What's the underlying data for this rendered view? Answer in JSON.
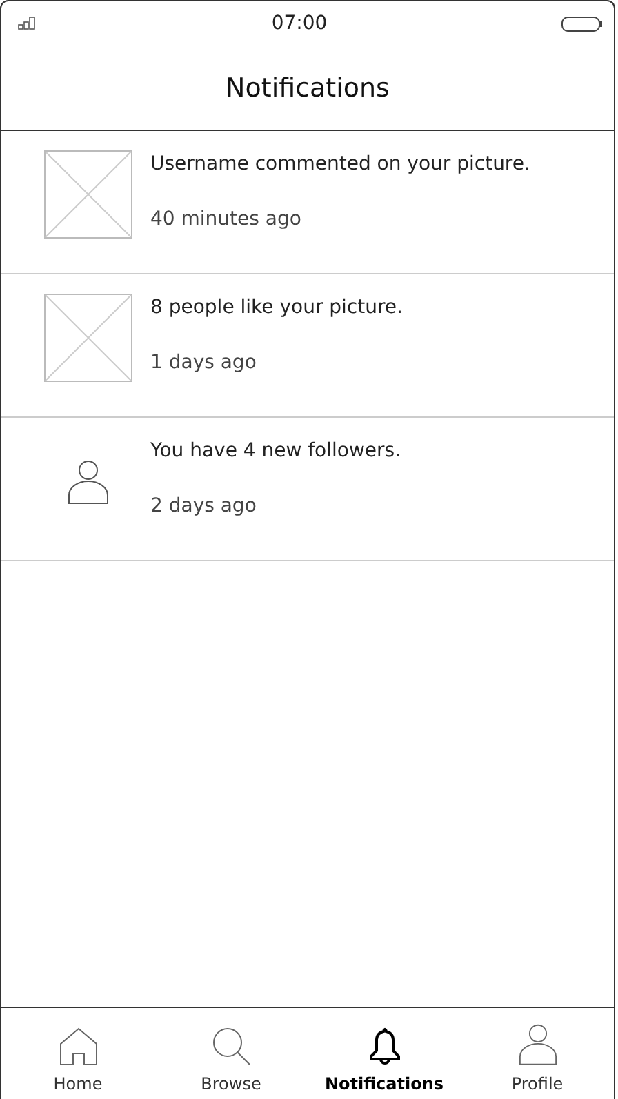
{
  "status_bar": {
    "time": "07:00"
  },
  "header": {
    "title": "Notifications"
  },
  "notifications": [
    {
      "kind": "image",
      "message": "Username commented on your picture.",
      "time": "40 minutes ago"
    },
    {
      "kind": "image",
      "message": "8 people like your picture.",
      "time": "1 days ago"
    },
    {
      "kind": "person",
      "message": "You have 4 new followers.",
      "time": "2 days ago"
    }
  ],
  "tab_bar": [
    {
      "kind": "home",
      "label": "Home",
      "selected": false
    },
    {
      "kind": "search",
      "label": "Browse",
      "selected": false
    },
    {
      "kind": "bell",
      "label": "Notifications",
      "selected": true
    },
    {
      "kind": "person",
      "label": "Profile",
      "selected": false
    }
  ]
}
